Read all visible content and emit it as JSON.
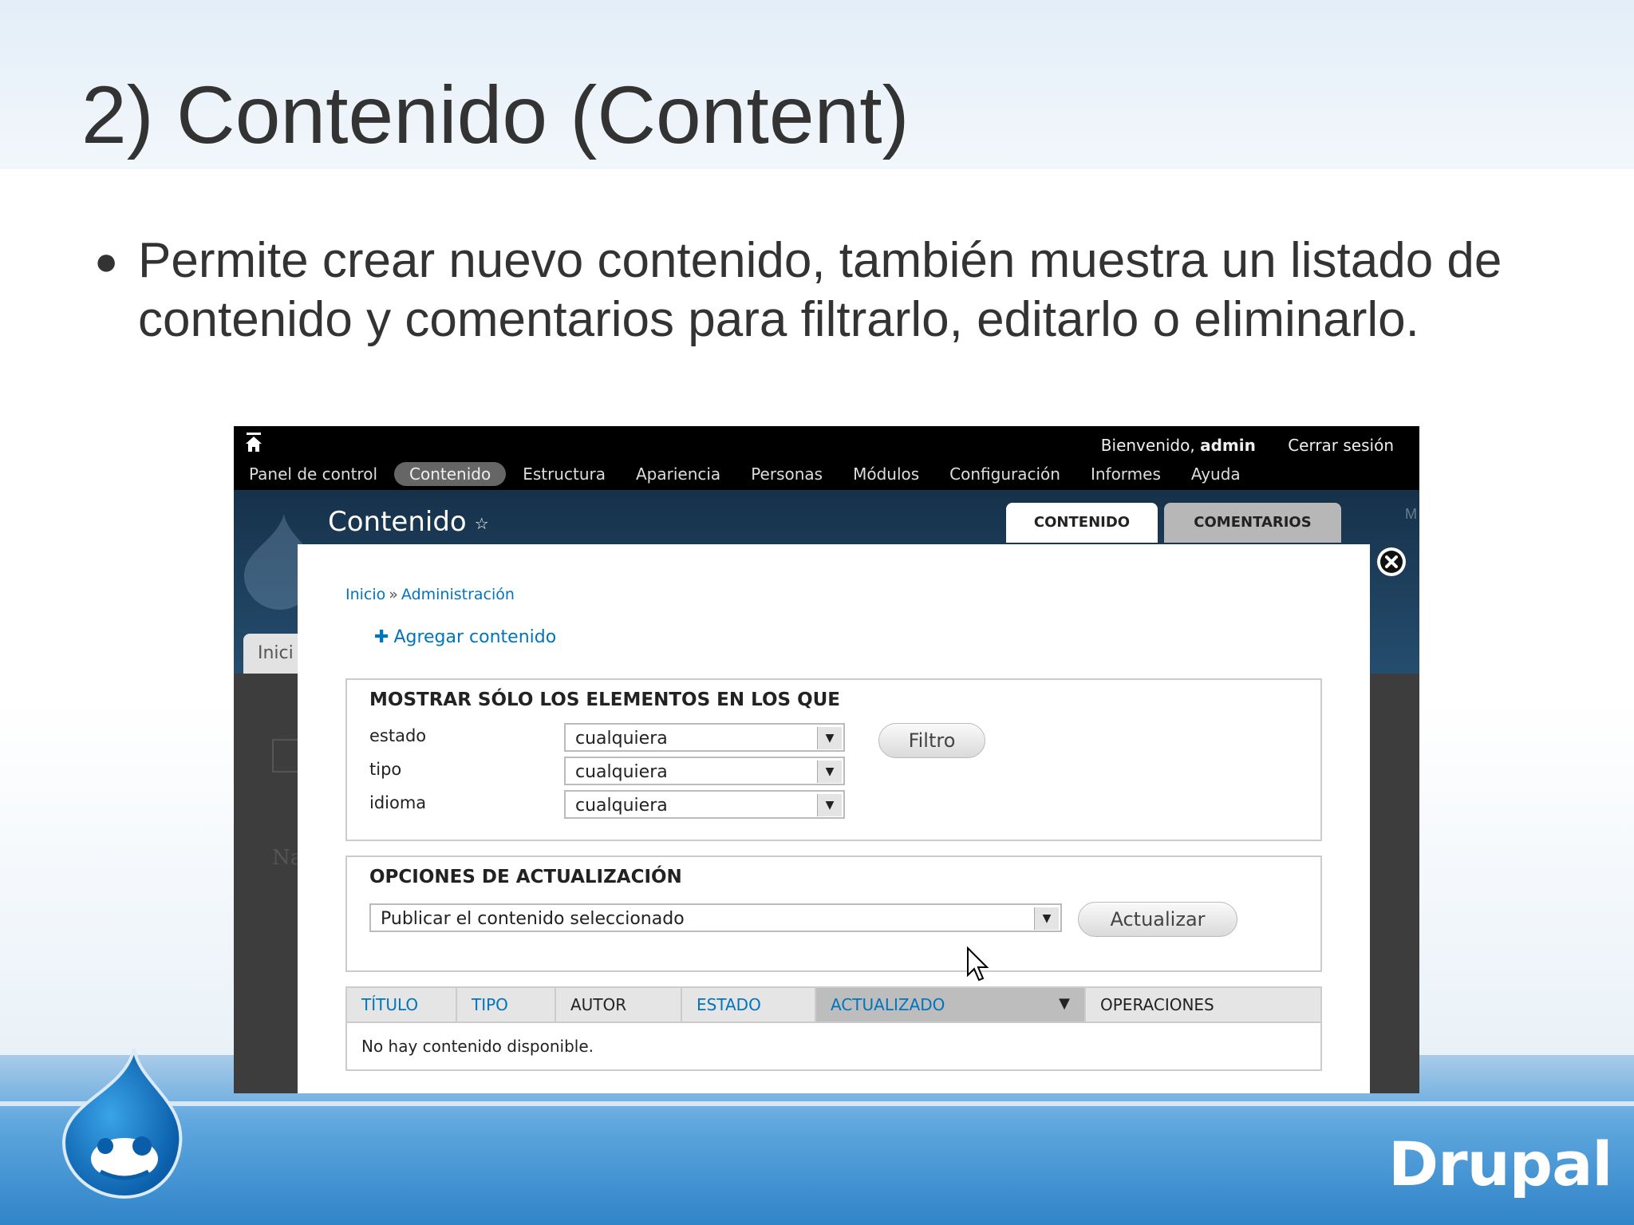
{
  "slide": {
    "title": "2) Contenido (Content)",
    "bullet": "Permite crear nuevo contenido, también muestra un listado de contenido y comentarios  para filtrarlo, editarlo o eliminarlo."
  },
  "admin_bar": {
    "welcome_prefix": "Bienvenido,",
    "user": "admin",
    "logout": "Cerrar sesión",
    "menu": [
      "Panel de control",
      "Contenido",
      "Estructura",
      "Apariencia",
      "Personas",
      "Módulos",
      "Configuración",
      "Informes",
      "Ayuda"
    ],
    "active_item": "Contenido"
  },
  "header": {
    "page_title": "Contenido",
    "tabs": [
      "CONTENIDO",
      "COMENTARIOS"
    ],
    "active_tab": "CONTENIDO",
    "side_fragment": "M"
  },
  "background_page": {
    "tab_fragment": "Inici",
    "text_fragment": "Na"
  },
  "overlay": {
    "breadcrumb": [
      "Inicio",
      "Administración"
    ],
    "breadcrumb_separator": "»",
    "add_link": "Agregar contenido",
    "filter": {
      "legend": "MOSTRAR SÓLO LOS ELEMENTOS EN LOS QUE",
      "fields": [
        {
          "label": "estado",
          "value": "cualquiera"
        },
        {
          "label": "tipo",
          "value": "cualquiera"
        },
        {
          "label": "idioma",
          "value": "cualquiera"
        }
      ],
      "button": "Filtro"
    },
    "update": {
      "legend": "OPCIONES DE ACTUALIZACIÓN",
      "selected_option": "Publicar el contenido seleccionado",
      "button": "Actualizar"
    },
    "table": {
      "columns": [
        "TÍTULO",
        "TIPO",
        "AUTOR",
        "ESTADO",
        "ACTUALIZADO",
        "OPERACIONES"
      ],
      "sorted_column": "ACTUALIZADO",
      "empty_message": "No hay contenido disponible."
    }
  },
  "footer": {
    "brand": "Drupal"
  },
  "colors": {
    "link": "#0074bd",
    "admin_bar": "#000000",
    "header_bg": "#1d3f5c",
    "footer_blue": "#2f84c9"
  }
}
